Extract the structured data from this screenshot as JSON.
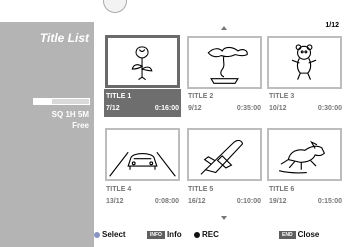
{
  "left_panel": {
    "title": "Title List",
    "remain_mode": "SQ 1H 5M",
    "free_label": "Free",
    "disc_usage_fraction": 0.32
  },
  "page_indicator": "1/12",
  "icons": {
    "scroll_up": "triangle-up",
    "scroll_down": "triangle-down",
    "select": "blue-dot",
    "rec": "black-dot",
    "disc": "disc-icon"
  },
  "thumbnails": [
    {
      "title": "TITLE 1",
      "date": "7/12",
      "length": "0:16:00",
      "image": "rose",
      "selected": true
    },
    {
      "title": "TITLE 2",
      "date": "9/12",
      "length": "0:35:00",
      "image": "bonsai-tree",
      "selected": false
    },
    {
      "title": "TITLE 3",
      "date": "10/12",
      "length": "0:30:00",
      "image": "teddy-bear",
      "selected": false
    },
    {
      "title": "TITLE  4",
      "date": "13/12",
      "length": "0:08:00",
      "image": "car",
      "selected": false
    },
    {
      "title": "TITLE  5",
      "date": "16/12",
      "length": "0:10:00",
      "image": "space-shuttle",
      "selected": false
    },
    {
      "title": "TITLE  6",
      "date": "19/12",
      "length": "0:15:00",
      "image": "dog",
      "selected": false
    }
  ],
  "footer": {
    "select_label": "Select",
    "info_badge": "INFO",
    "info_label": "Info",
    "rec_label": "REC",
    "end_badge": "END",
    "close_label": "Close"
  },
  "colors": {
    "panel_gray": "#b4b4b4",
    "selected_bar": "#6e6e6e",
    "thumb_border": "#bdbdbd",
    "select_dot": "#8a94c4"
  }
}
